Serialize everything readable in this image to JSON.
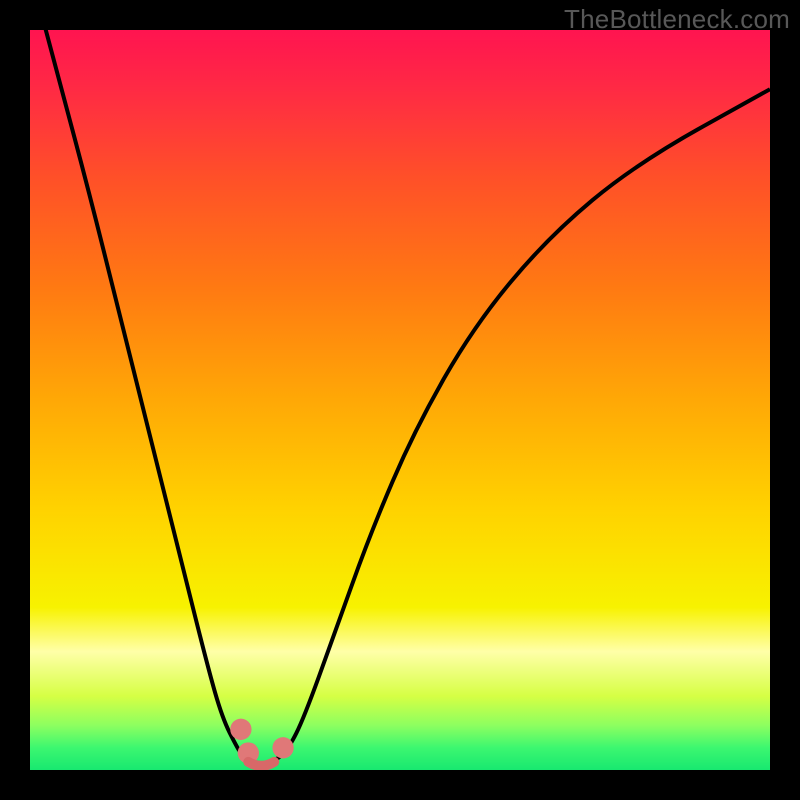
{
  "watermark": "TheBottleneck.com",
  "chart_data": {
    "type": "line",
    "title": "",
    "xlabel": "",
    "ylabel": "",
    "xlim": [
      0,
      100
    ],
    "ylim": [
      0,
      100
    ],
    "grid": false,
    "legend": false,
    "background_gradient": {
      "stops": [
        {
          "offset": 0.0,
          "color": "#ff1450"
        },
        {
          "offset": 0.08,
          "color": "#ff2a44"
        },
        {
          "offset": 0.2,
          "color": "#ff5028"
        },
        {
          "offset": 0.35,
          "color": "#ff7a12"
        },
        {
          "offset": 0.5,
          "color": "#ffa806"
        },
        {
          "offset": 0.65,
          "color": "#ffd300"
        },
        {
          "offset": 0.78,
          "color": "#f7f200"
        },
        {
          "offset": 0.84,
          "color": "#ffffa8"
        },
        {
          "offset": 0.9,
          "color": "#d6ff44"
        },
        {
          "offset": 0.94,
          "color": "#8cff60"
        },
        {
          "offset": 0.97,
          "color": "#3cf770"
        },
        {
          "offset": 1.0,
          "color": "#18e870"
        }
      ]
    },
    "series": [
      {
        "name": "bottleneck-curve",
        "x": [
          0,
          4,
          8,
          12,
          16,
          20,
          24,
          26,
          28,
          29,
          30,
          31,
          32,
          33.5,
          35,
          37,
          41,
          46,
          52,
          60,
          70,
          82,
          100
        ],
        "y": [
          108,
          93,
          78,
          62,
          46,
          30,
          14,
          7,
          3,
          1.5,
          0.8,
          0.5,
          0.8,
          1.5,
          3,
          7,
          18,
          32,
          46,
          60,
          72,
          82,
          92
        ]
      }
    ],
    "markers": [
      {
        "name": "marker-left-top",
        "x": 28.5,
        "y": 5.5,
        "r": 1.6
      },
      {
        "name": "marker-left-bottom",
        "x": 29.5,
        "y": 2.3,
        "r": 1.6
      },
      {
        "name": "marker-right-valley",
        "x": 34.2,
        "y": 3.0,
        "r": 1.6
      },
      {
        "name": "valley-connector",
        "type": "path",
        "from": [
          29.5,
          1.1
        ],
        "to": [
          33.0,
          1.1
        ]
      }
    ]
  }
}
